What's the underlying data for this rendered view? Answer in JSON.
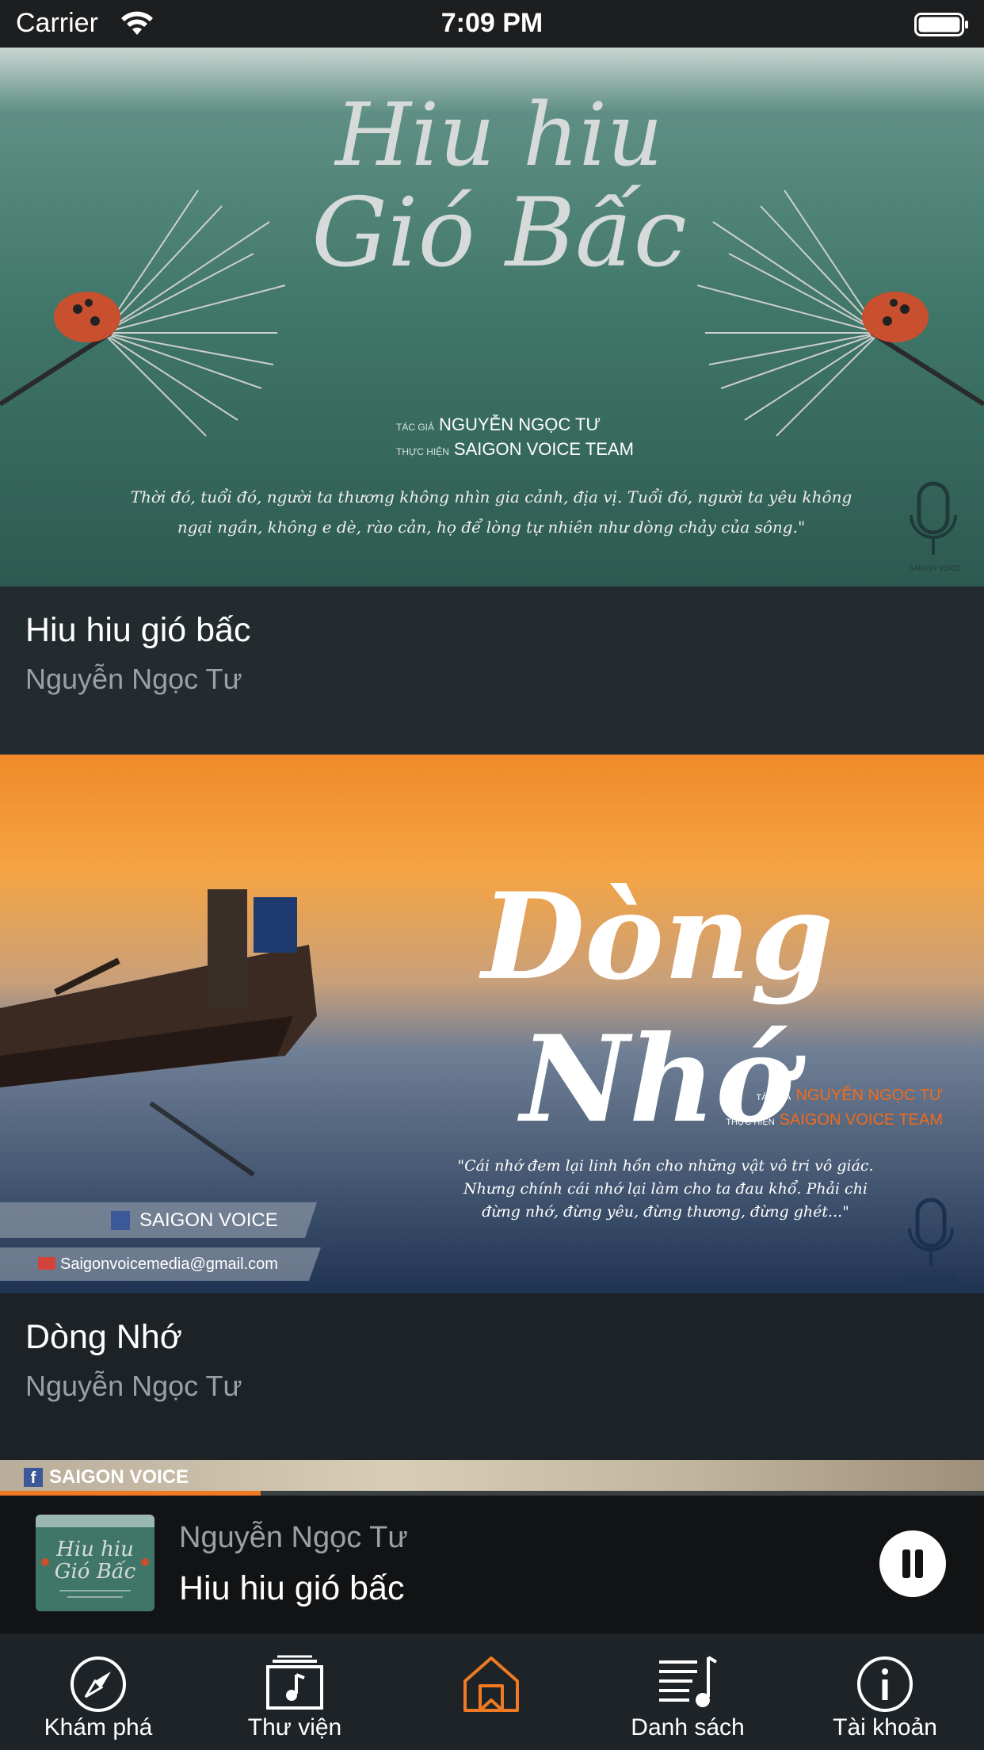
{
  "status_bar": {
    "carrier": "Carrier",
    "time": "7:09 PM"
  },
  "feed": [
    {
      "title": "Hiu hiu gió bấc",
      "author": "Nguyễn Ngọc Tư",
      "cover_text": {
        "line1": "Hiu hiu",
        "line2": "Gió Bấc",
        "credit_author_label": "TÁC GIẢ",
        "credit_author": "NGUYỄN NGỌC TƯ",
        "credit_team_label": "THỰC HIỆN",
        "credit_team": "SAIGON VOICE TEAM",
        "quote_1": "Thời đó, tuổi đó, người ta thương không nhìn gia cảnh, địa vị. Tuổi đó, người ta yêu không",
        "quote_2": "ngại ngần, không e dè, rào cản, họ để lòng tự nhiên như dòng chảy của sông.\"",
        "logo": "SAIGON VOICE"
      }
    },
    {
      "title": "Dòng Nhớ",
      "author": "Nguyễn Ngọc Tư",
      "cover_text": {
        "title_art": "Dòng Nhớ",
        "credit_author_label": "TÁC GIẢ",
        "credit_author": "NGUYỄN NGỌC TƯ",
        "credit_team_label": "THỰC HIỆN",
        "credit_team": "SAIGON VOICE TEAM",
        "quote_1": "\"Cái nhớ đem lại linh hồn cho những vật vô tri vô giác.",
        "quote_2": "Nhưng chính cái nhớ lại làm cho ta đau khổ. Phải chi",
        "quote_3": "đừng nhớ, đừng yêu, đừng thương, đừng ghét...\"",
        "facebook": "SAIGON VOICE",
        "email": "Saigonvoicemedia@gmail.com",
        "logo": "SAIGON VOICE"
      }
    },
    {
      "cover_text": {
        "facebook": "SAIGON VOICE"
      }
    }
  ],
  "mini_player": {
    "author": "Nguyễn Ngọc Tư",
    "title": "Hiu hiu gió bấc",
    "progress_percent": 26.5,
    "accent_color": "#ef7a22"
  },
  "tab_bar": {
    "active_color": "#ef7a22",
    "tabs": [
      {
        "label": "Khám phá",
        "icon": "compass-icon"
      },
      {
        "label": "Thư viện",
        "icon": "music-library-icon"
      },
      {
        "label": "",
        "icon": "home-icon",
        "active": true
      },
      {
        "label": "Danh sách",
        "icon": "playlist-icon"
      },
      {
        "label": "Tài khoản",
        "icon": "info-icon"
      }
    ]
  }
}
